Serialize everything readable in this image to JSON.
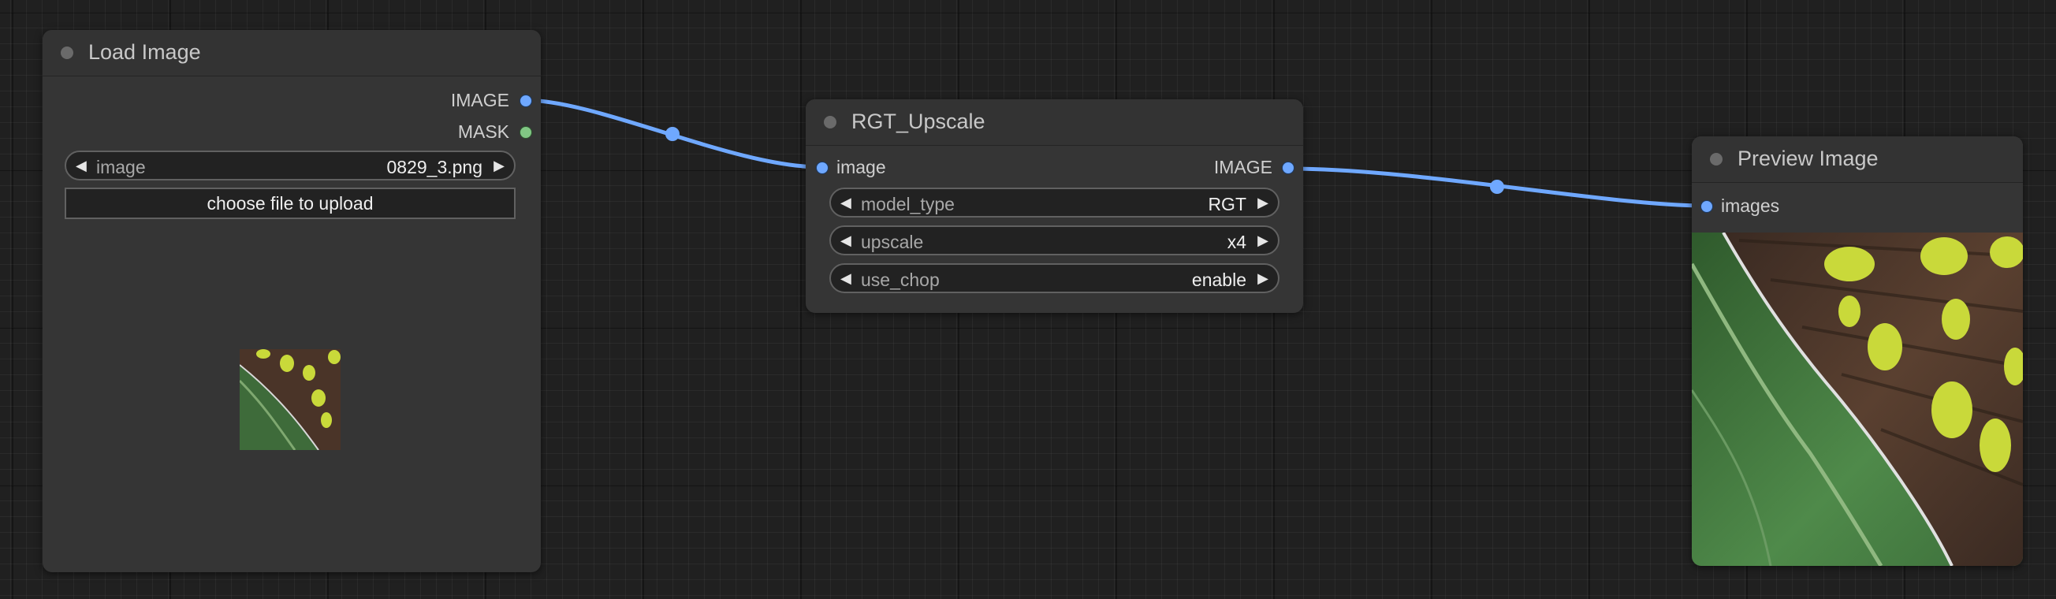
{
  "colors": {
    "image_link": "#6fa8ff",
    "mask_slot": "#81c784",
    "canvas": "#202020",
    "node_body": "#353535"
  },
  "nodes": {
    "load_image": {
      "title": "Load Image",
      "outputs": [
        "IMAGE",
        "MASK"
      ],
      "widget": {
        "name": "image",
        "value": "0829_3.png"
      },
      "upload_button": "choose file to upload"
    },
    "rgt_upscale": {
      "title": "RGT_Upscale",
      "input": "image",
      "output": "IMAGE",
      "widgets": [
        {
          "name": "model_type",
          "value": "RGT"
        },
        {
          "name": "upscale",
          "value": "x4"
        },
        {
          "name": "use_chop",
          "value": "enable"
        }
      ]
    },
    "preview_image": {
      "title": "Preview Image",
      "input": "images"
    }
  },
  "icons": {
    "arrow_left": "◀",
    "arrow_right": "▶"
  }
}
